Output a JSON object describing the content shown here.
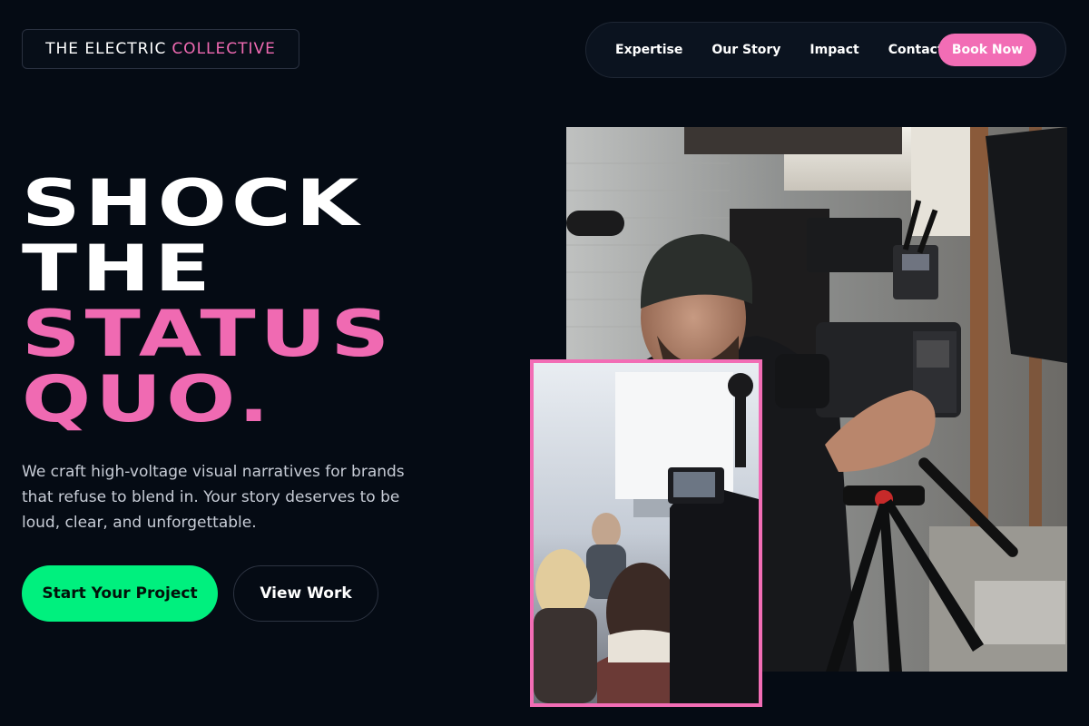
{
  "brand": {
    "name_part1": "THE ELECTRIC",
    "name_part2": "COLLECTIVE"
  },
  "nav": {
    "items": [
      {
        "label": "Expertise"
      },
      {
        "label": "Our Story"
      },
      {
        "label": "Impact"
      },
      {
        "label": "Contact"
      }
    ],
    "cta_label": "Book Now"
  },
  "hero": {
    "headline": {
      "line1": "SHOCK",
      "line2": "THE",
      "line3": "STATUS",
      "line4": "QUO."
    },
    "description": "We craft high-voltage visual narratives for brands that refuse to blend in. Your story deserves to be loud, clear, and unforgettable.",
    "primary_button": "Start Your Project",
    "secondary_button": "View Work"
  },
  "colors": {
    "background": "#050b14",
    "accent_pink": "#f26db5",
    "accent_green": "#00f07e"
  },
  "images": {
    "main": "videographer-with-camera-rig-photo",
    "inset": "film-crew-behind-the-scenes-photo"
  }
}
